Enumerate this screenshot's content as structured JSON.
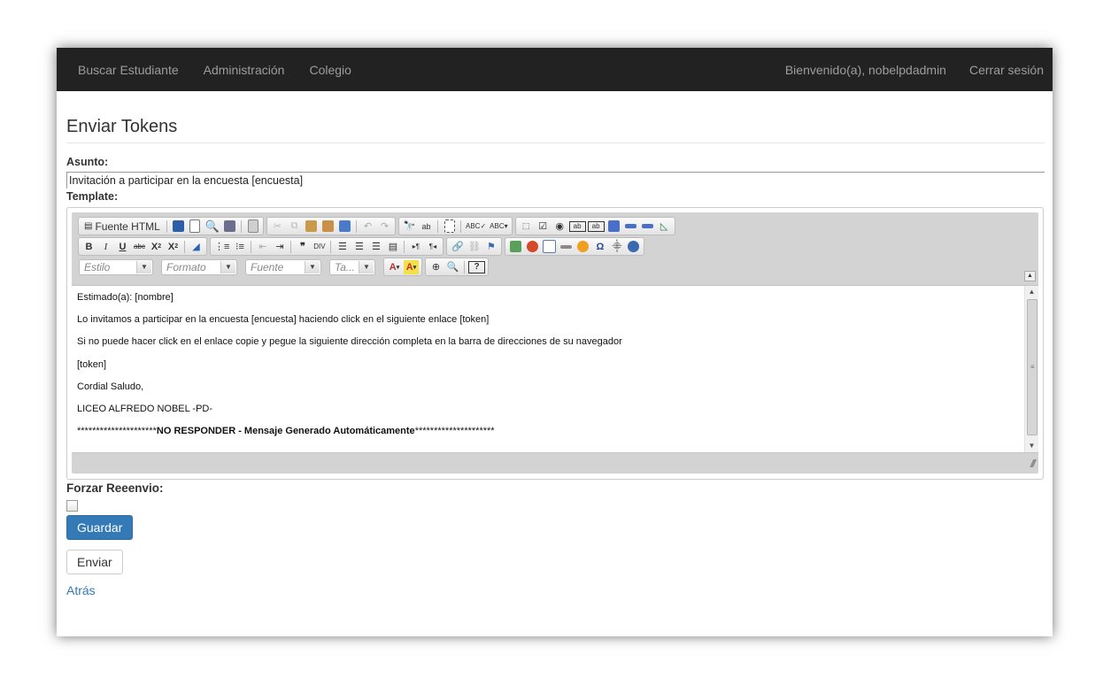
{
  "navbar": {
    "left": [
      "Buscar Estudiante",
      "Administración",
      "Colegio"
    ],
    "welcome": "Bienvenido(a), nobelpdadmin",
    "logout": "Cerrar sesión"
  },
  "page": {
    "title": "Enviar Tokens"
  },
  "form": {
    "subject_label": "Asunto:",
    "subject_value": "Invitación a participar en la encuesta [encuesta]",
    "template_label": "Template:",
    "force_label": "Forzar Reeenvio:",
    "save_button": "Guardar",
    "send_button": "Enviar",
    "back_link": "Atrás"
  },
  "editor": {
    "source_button": "Fuente HTML",
    "combos": {
      "style": "Estilo",
      "format": "Formato",
      "font": "Fuente",
      "size": "Ta..."
    },
    "body": [
      "Estimado(a): [nombre]",
      "Lo invitamos a participar en la encuesta [encuesta] haciendo click en el siguiente enlace [token]",
      "Si no puede hacer click en el enlace copie y pegue la siguiente dirección completa en la barra de direcciones de su navegador",
      "[token]",
      "Cordial Saludo,",
      "LICEO ALFREDO NOBEL -PD-"
    ],
    "footer_stars_left": "*********************",
    "footer_bold": "NO RESPONDER - Mensaje Generado Automáticamente",
    "footer_stars_right": "*********************"
  },
  "colors": {
    "navbar": "#222222",
    "primary": "#337ab7",
    "link": "#337ab7"
  }
}
